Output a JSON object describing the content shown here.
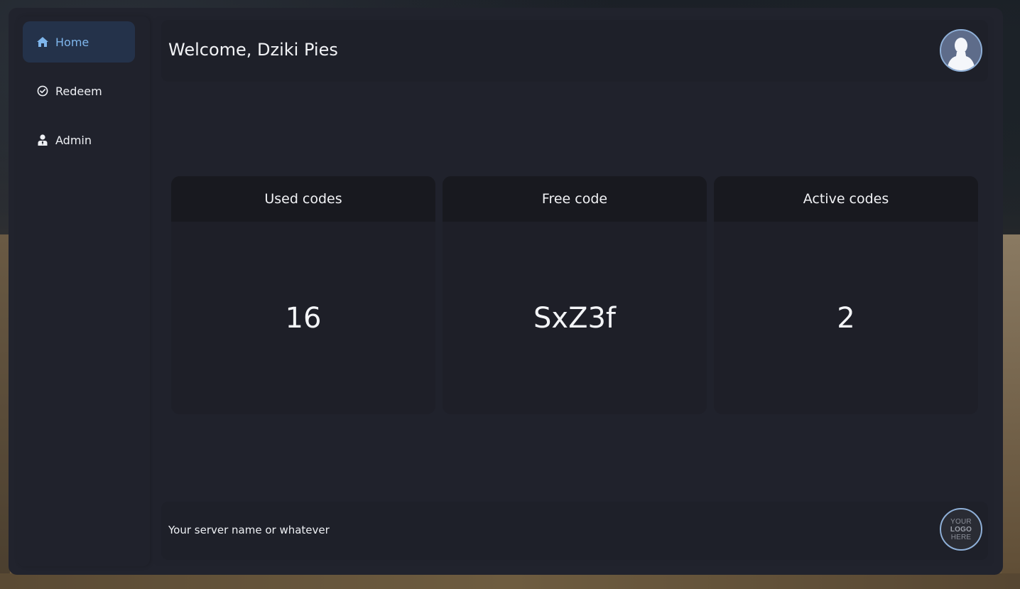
{
  "sidebar": {
    "items": [
      {
        "label": "Home",
        "icon": "home-icon",
        "active": true
      },
      {
        "label": "Redeem",
        "icon": "check-circle-icon",
        "active": false
      },
      {
        "label": "Admin",
        "icon": "user-tie-icon",
        "active": false
      }
    ]
  },
  "header": {
    "welcome": "Welcome, Dziki Pies",
    "avatar_icon": "user-avatar-icon"
  },
  "stats": [
    {
      "title": "Used codes",
      "value": "16"
    },
    {
      "title": "Free code",
      "value": "SxZ3f"
    },
    {
      "title": "Active codes",
      "value": "2"
    }
  ],
  "footer": {
    "server_name": "Your server name or whatever",
    "logo": {
      "line1": "YOUR",
      "line2": "LOGO",
      "line3": "HERE"
    }
  },
  "colors": {
    "accent": "#7fb6ec",
    "active_bg": "#24324a",
    "panel_bg": "#21232d"
  }
}
